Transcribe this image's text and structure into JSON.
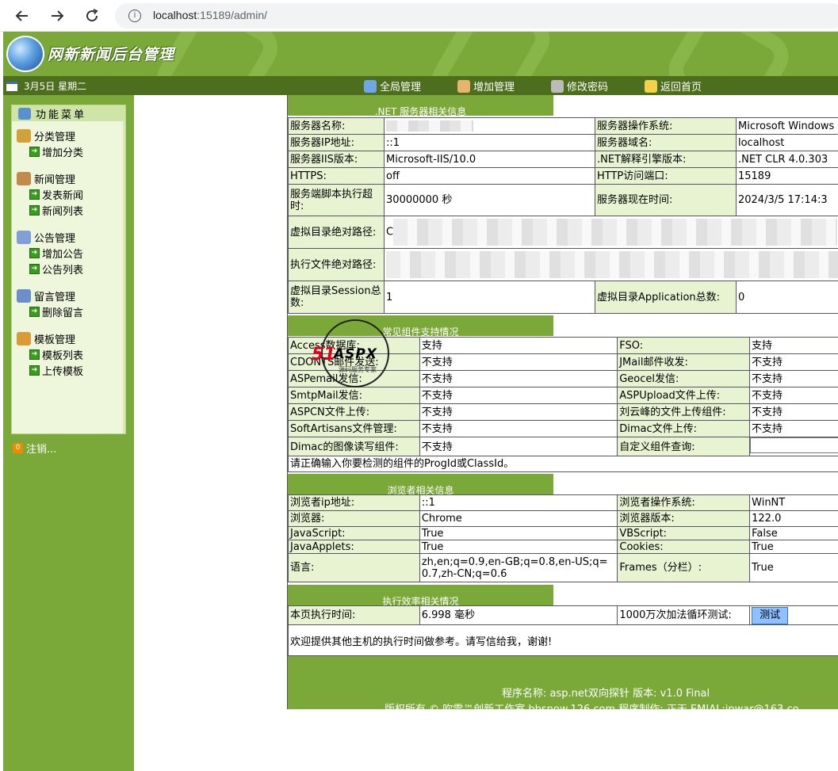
{
  "browser": {
    "url_host": "localhost",
    "url_rest": ":15189/admin/"
  },
  "header": {
    "logo_text": "网新新闻后台管理"
  },
  "topnav": {
    "date": "3月5日 星期二",
    "links": [
      "全局管理",
      "增加管理",
      "修改密码",
      "返回首页"
    ]
  },
  "sidebar": {
    "title": "功能菜单",
    "groups": [
      {
        "head": "分类管理",
        "items": [
          "增加分类"
        ]
      },
      {
        "head": "新闻管理",
        "items": [
          "发表新闻",
          "新闻列表"
        ]
      },
      {
        "head": "公告管理",
        "items": [
          "增加公告",
          "公告列表"
        ]
      },
      {
        "head": "留言管理",
        "items": [
          "删除留言"
        ]
      },
      {
        "head": "模板管理",
        "items": [
          "模板列表",
          "上传模板"
        ]
      }
    ],
    "logout": "注销..."
  },
  "server": {
    "title": ".NET 服务器相关信息",
    "rows": [
      [
        "服务器名称:",
        "",
        "服务器操作系统:",
        "Microsoft Windows"
      ],
      [
        "服务器IP地址:",
        "::1",
        "服务器域名:",
        "localhost"
      ],
      [
        "服务器IIS版本:",
        "Microsoft-IIS/10.0",
        ".NET解释引擎版本:",
        ".NET CLR 4.0.303"
      ],
      [
        "HTTPS:",
        "off",
        "HTTP访问端口:",
        "15189"
      ],
      [
        "服务端脚本执行超时:",
        "30000000 秒",
        "服务器现在时间:",
        "2024/3/5 17:14:3"
      ]
    ],
    "vdir_path_label": "虚拟目录绝对路径:",
    "vdir_path_value": "C",
    "exec_path_label": "执行文件绝对路径:",
    "session_label": "虚拟目录Session总数:",
    "session_value": "1",
    "app_label": "虚拟目录Application总数:",
    "app_value": "0"
  },
  "components": {
    "title": "常见组件支持情况",
    "rows": [
      [
        "Access数据库:",
        "支持",
        "FSO:",
        "支持"
      ],
      [
        "CDONTS邮件发送:",
        "不支持",
        "JMail邮件收发:",
        "不支持"
      ],
      [
        "ASPemail发信:",
        "不支持",
        "Geocel发信:",
        "不支持"
      ],
      [
        "SmtpMail发信:",
        "不支持",
        "ASPUpload文件上传:",
        "不支持"
      ],
      [
        "ASPCN文件上传:",
        "不支持",
        "刘云峰的文件上传组件:",
        "不支持"
      ],
      [
        "SoftArtisans文件管理:",
        "不支持",
        "Dimac文件上传:",
        "不支持"
      ]
    ],
    "last_left_label": "Dimac的图像读写组件:",
    "last_left_value": "不支持",
    "custom_label": "自定义组件查询:",
    "note": "请正确输入你要检测的组件的ProgId或ClassId。"
  },
  "browserinfo": {
    "title": "浏览者相关信息",
    "rows": [
      [
        "浏览者ip地址:",
        "::1",
        "浏览者操作系统:",
        "WinNT"
      ],
      [
        "浏览器:",
        "Chrome",
        "浏览器版本:",
        "122.0"
      ],
      [
        "JavaScript:",
        "True",
        "VBScript:",
        "False"
      ],
      [
        "JavaApplets:",
        "True",
        "Cookies:",
        "True"
      ],
      [
        "语言:",
        "zh,en;q=0.9,en-GB;q=0.8,en-US;q=0.7,zh-CN;q=0.6",
        "Frames（分栏）:",
        "True"
      ]
    ]
  },
  "efficiency": {
    "title": "执行效率相关情况",
    "time_label": "本页执行时间:",
    "time_value": "6.998 毫秒",
    "loop_label": "1000万次加法循环测试:",
    "test_button": "测试",
    "note": "欢迎提供其他主机的执行时间做参考。请写信给我，谢谢!"
  },
  "footer": {
    "line1": "程序名称: asp.net双向探针 版本: v1.0 Final",
    "line2": "版权所有 © 吹雪™创新工作室 bbsnow.126.com 程序制作: 正天 EMIAL:ipwar@163.co"
  },
  "watermark": {
    "t1": "51",
    "t2": "ASPX",
    "t3": "源码服务专家"
  }
}
